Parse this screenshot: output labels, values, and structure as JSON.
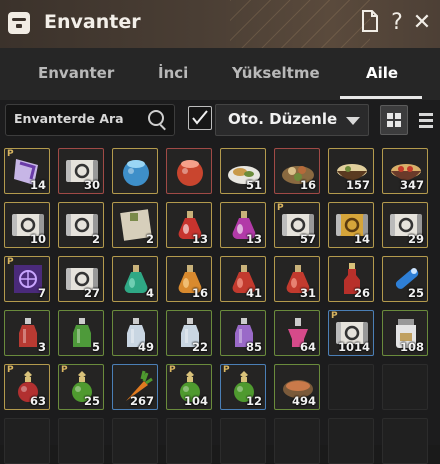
{
  "window": {
    "title": "Envanter",
    "buttons": {
      "doc_icon": "document-icon",
      "help": "?",
      "close": "✕"
    }
  },
  "tabs": [
    {
      "label": "Envanter",
      "active": false
    },
    {
      "label": "İnci",
      "active": false
    },
    {
      "label": "Yükseltme",
      "active": false
    },
    {
      "label": "Aile",
      "active": true
    }
  ],
  "toolbar": {
    "search_placeholder": "Envanterde Ara",
    "auto_sort_checked": true,
    "auto_sort_label": "Oto. Düzenle",
    "view_mode": "grid"
  },
  "items": [
    {
      "icon": "scroll-purple",
      "count": "14",
      "p": true,
      "rarity": "gold"
    },
    {
      "icon": "scroll-white",
      "count": "30",
      "p": false,
      "rarity": "red"
    },
    {
      "icon": "elixir-blue",
      "count": "",
      "p": false,
      "rarity": "gold"
    },
    {
      "icon": "elixir-red",
      "count": "",
      "p": false,
      "rarity": "red"
    },
    {
      "icon": "food-plate",
      "count": "51",
      "p": false,
      "rarity": "gold"
    },
    {
      "icon": "food-platter",
      "count": "16",
      "p": false,
      "rarity": "red"
    },
    {
      "icon": "food-bowl",
      "count": "157",
      "p": false,
      "rarity": "gold"
    },
    {
      "icon": "food-bowl-red",
      "count": "347",
      "p": false,
      "rarity": "gold"
    },
    {
      "icon": "scroll-white",
      "count": "10",
      "p": false,
      "rarity": "gold"
    },
    {
      "icon": "scroll-white",
      "count": "2",
      "p": false,
      "rarity": "gold"
    },
    {
      "icon": "letter",
      "count": "2",
      "p": false,
      "rarity": "gold"
    },
    {
      "icon": "potion-red-small",
      "count": "13",
      "p": false,
      "rarity": "gold"
    },
    {
      "icon": "potion-purple",
      "count": "13",
      "p": false,
      "rarity": "gold"
    },
    {
      "icon": "scroll-white",
      "count": "57",
      "p": true,
      "rarity": "gold"
    },
    {
      "icon": "scroll-gold",
      "count": "14",
      "p": false,
      "rarity": "gold"
    },
    {
      "icon": "scroll-white",
      "count": "29",
      "p": false,
      "rarity": "gold"
    },
    {
      "icon": "scroll-purple-book",
      "count": "7",
      "p": true,
      "rarity": "gold"
    },
    {
      "icon": "scroll-white",
      "count": "27",
      "p": false,
      "rarity": "gold"
    },
    {
      "icon": "potion-green-flask",
      "count": "4",
      "p": false,
      "rarity": "gold"
    },
    {
      "icon": "potion-orange",
      "count": "16",
      "p": false,
      "rarity": "gold"
    },
    {
      "icon": "potion-red-flask",
      "count": "41",
      "p": false,
      "rarity": "gold"
    },
    {
      "icon": "potion-red-flask",
      "count": "31",
      "p": false,
      "rarity": "gold"
    },
    {
      "icon": "potion-red-tall",
      "count": "26",
      "p": false,
      "rarity": "gold"
    },
    {
      "icon": "potion-blue-tube",
      "count": "25",
      "p": false,
      "rarity": "gold"
    },
    {
      "icon": "bottle-red",
      "count": "3",
      "p": false,
      "rarity": "green"
    },
    {
      "icon": "bottle-green",
      "count": "5",
      "p": false,
      "rarity": "green"
    },
    {
      "icon": "bottle-white",
      "count": "49",
      "p": false,
      "rarity": "green"
    },
    {
      "icon": "bottle-white",
      "count": "22",
      "p": false,
      "rarity": "green"
    },
    {
      "icon": "bottle-purple",
      "count": "85",
      "p": false,
      "rarity": "green"
    },
    {
      "icon": "bottle-pink",
      "count": "64",
      "p": false,
      "rarity": "green"
    },
    {
      "icon": "scroll-white",
      "count": "1014",
      "p": true,
      "rarity": "blue"
    },
    {
      "icon": "jar-white",
      "count": "108",
      "p": false,
      "rarity": "green"
    },
    {
      "icon": "potion-ornate-red",
      "count": "63",
      "p": true,
      "rarity": "gold"
    },
    {
      "icon": "potion-ornate-green",
      "count": "25",
      "p": true,
      "rarity": "green"
    },
    {
      "icon": "carrot",
      "count": "267",
      "p": false,
      "rarity": "blue"
    },
    {
      "icon": "potion-ornate-green",
      "count": "104",
      "p": true,
      "rarity": "green"
    },
    {
      "icon": "potion-ornate-green",
      "count": "12",
      "p": true,
      "rarity": "blue"
    },
    {
      "icon": "bowl-grain",
      "count": "494",
      "p": false,
      "rarity": "green"
    },
    {
      "icon": "",
      "count": "",
      "p": false,
      "rarity": "empty"
    },
    {
      "icon": "",
      "count": "",
      "p": false,
      "rarity": "empty"
    },
    {
      "icon": "",
      "count": "",
      "p": false,
      "rarity": "empty"
    },
    {
      "icon": "",
      "count": "",
      "p": false,
      "rarity": "empty"
    },
    {
      "icon": "",
      "count": "",
      "p": false,
      "rarity": "empty"
    },
    {
      "icon": "",
      "count": "",
      "p": false,
      "rarity": "empty"
    },
    {
      "icon": "",
      "count": "",
      "p": false,
      "rarity": "empty"
    },
    {
      "icon": "",
      "count": "",
      "p": false,
      "rarity": "empty"
    },
    {
      "icon": "",
      "count": "",
      "p": false,
      "rarity": "empty"
    },
    {
      "icon": "",
      "count": "",
      "p": false,
      "rarity": "empty"
    }
  ]
}
